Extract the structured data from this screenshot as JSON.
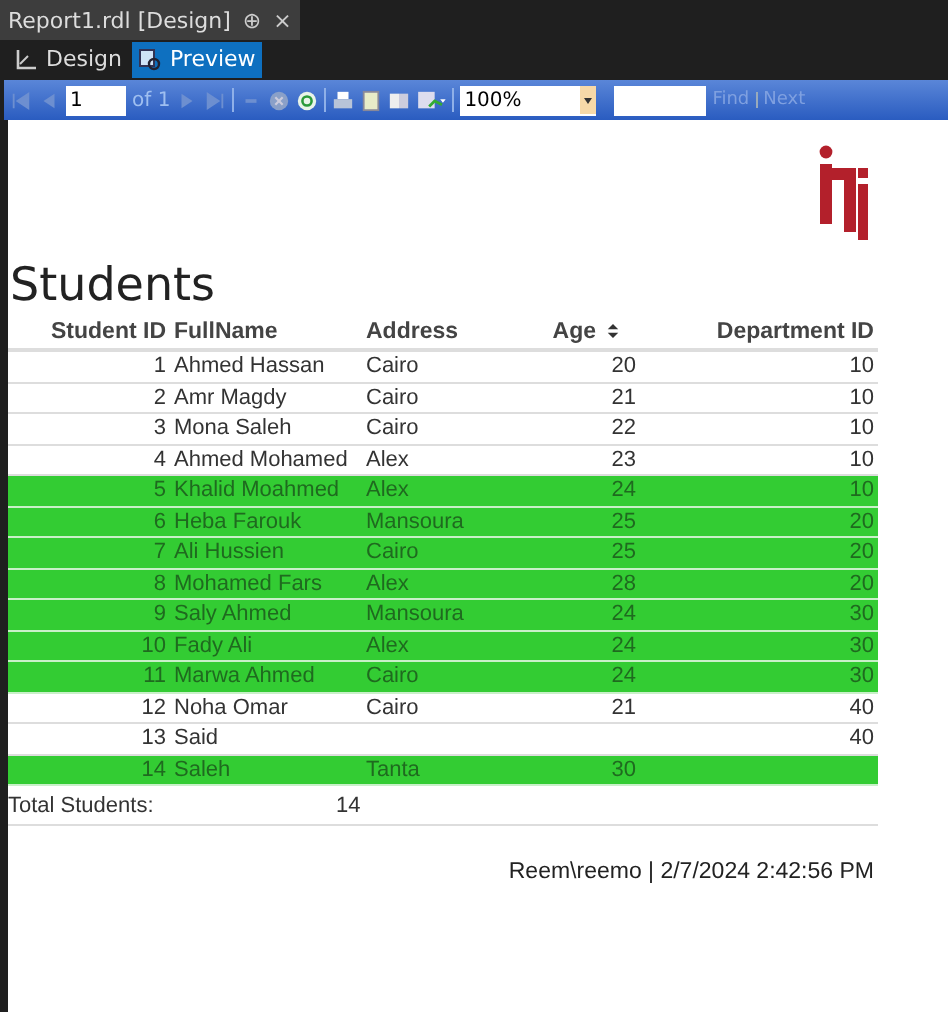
{
  "document_tab": {
    "title": "Report1.rdl [Design]",
    "pin": "⊕",
    "close": "×"
  },
  "view_tabs": [
    {
      "label": "Design",
      "selected": false
    },
    {
      "label": "Preview",
      "selected": true
    }
  ],
  "toolbar": {
    "page": "1",
    "page_count_label": "of 1",
    "zoom": "100%",
    "find_label": "Find",
    "next_label": "Next"
  },
  "report": {
    "title": "Students",
    "columns": [
      {
        "label": "Student ID",
        "sortable": false
      },
      {
        "label": "FullName",
        "sortable": false
      },
      {
        "label": "Address",
        "sortable": false
      },
      {
        "label": "Age",
        "sortable": true
      },
      {
        "label": "Department ID",
        "sortable": false
      }
    ],
    "rows": [
      {
        "cells": [
          "1",
          "Ahmed Hassan",
          "Cairo",
          "20",
          "10"
        ],
        "highlighted": false
      },
      {
        "cells": [
          "2",
          "Amr Magdy",
          "Cairo",
          "21",
          "10"
        ],
        "highlighted": false
      },
      {
        "cells": [
          "3",
          "Mona Saleh",
          "Cairo",
          "22",
          "10"
        ],
        "highlighted": false
      },
      {
        "cells": [
          "4",
          "Ahmed Mohamed",
          "Alex",
          "23",
          "10"
        ],
        "highlighted": false
      },
      {
        "cells": [
          "5",
          "Khalid Moahmed",
          "Alex",
          "24",
          "10"
        ],
        "highlighted": true
      },
      {
        "cells": [
          "6",
          "Heba Farouk",
          "Mansoura",
          "25",
          "20"
        ],
        "highlighted": true
      },
      {
        "cells": [
          "7",
          "Ali Hussien",
          "Cairo",
          "25",
          "20"
        ],
        "highlighted": true
      },
      {
        "cells": [
          "8",
          "Mohamed Fars",
          "Alex",
          "28",
          "20"
        ],
        "highlighted": true
      },
      {
        "cells": [
          "9",
          "Saly Ahmed",
          "Mansoura",
          "24",
          "30"
        ],
        "highlighted": true
      },
      {
        "cells": [
          "10",
          "Fady Ali",
          "Alex",
          "24",
          "30"
        ],
        "highlighted": true
      },
      {
        "cells": [
          "11",
          "Marwa Ahmed",
          "Cairo",
          "24",
          "30"
        ],
        "highlighted": true
      },
      {
        "cells": [
          "12",
          "Noha Omar",
          "Cairo",
          "21",
          "40"
        ],
        "highlighted": false
      },
      {
        "cells": [
          "13",
          "Said",
          "",
          "",
          "40"
        ],
        "highlighted": false
      },
      {
        "cells": [
          "14",
          " Saleh",
          "Tanta",
          "30",
          ""
        ],
        "highlighted": true
      }
    ],
    "total_label": "Total Students:",
    "total_value": "14",
    "footer": "Reem\\reemo | 2/7/2024 2:42:56 PM"
  }
}
